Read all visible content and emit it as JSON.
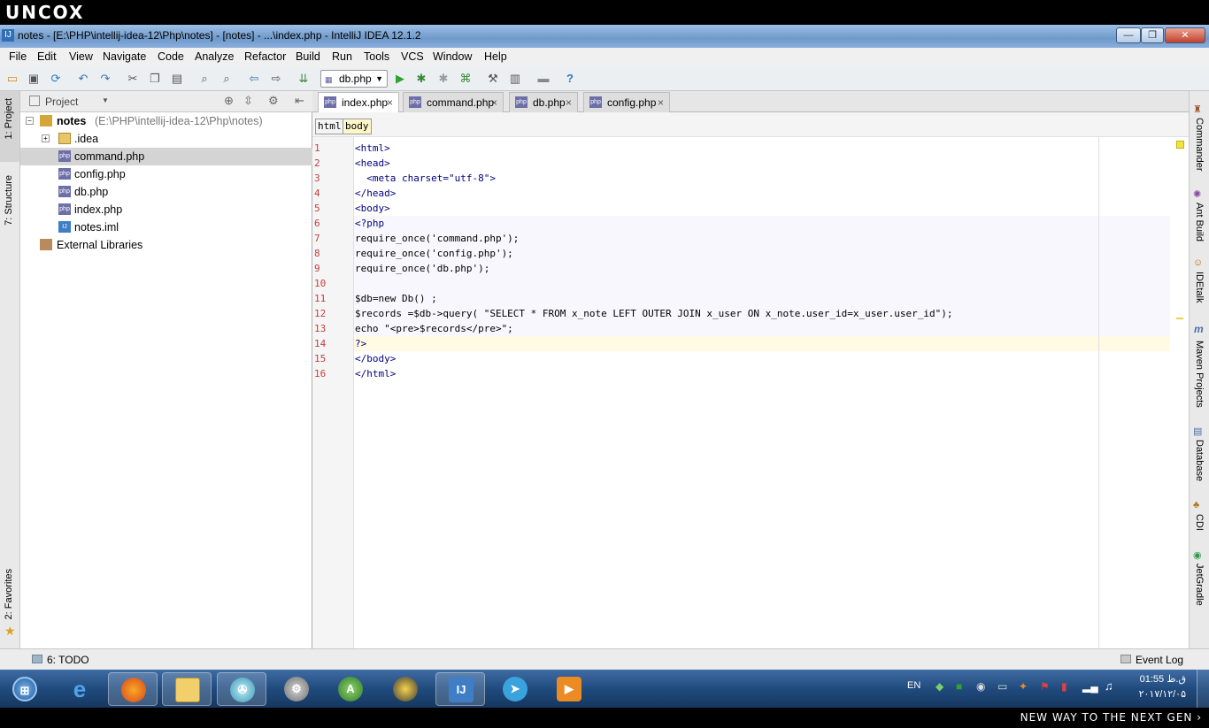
{
  "brand": {
    "logo": "UNCOX",
    "footer": "NEW WAY TO THE NEXT GEN ›"
  },
  "window": {
    "title": "notes - [E:\\PHP\\intellij-idea-12\\Php\\notes] - [notes] - ...\\index.php - IntelliJ IDEA 12.1.2",
    "minimize": "—",
    "maximize": "❐",
    "close": "✕"
  },
  "menu": [
    "File",
    "Edit",
    "View",
    "Navigate",
    "Code",
    "Analyze",
    "Refactor",
    "Build",
    "Run",
    "Tools",
    "VCS",
    "Window",
    "Help"
  ],
  "toolbar": {
    "run_config": "db.php",
    "help": "?"
  },
  "left_tool_tabs": {
    "project": "1: Project",
    "structure": "7: Structure",
    "favorites": "2: Favorites"
  },
  "project": {
    "header": "Project",
    "root": {
      "name": "notes",
      "path": "(E:\\PHP\\intellij-idea-12\\Php\\notes)"
    },
    "items": [
      {
        "name": ".idea",
        "type": "folder"
      },
      {
        "name": "command.php",
        "type": "php"
      },
      {
        "name": "config.php",
        "type": "php"
      },
      {
        "name": "db.php",
        "type": "php"
      },
      {
        "name": "index.php",
        "type": "php"
      },
      {
        "name": "notes.iml",
        "type": "iml"
      }
    ],
    "external": "External Libraries"
  },
  "tabs": [
    {
      "label": "index.php",
      "active": true
    },
    {
      "label": "command.php",
      "active": false
    },
    {
      "label": "db.php",
      "active": false
    },
    {
      "label": "config.php",
      "active": false
    }
  ],
  "breadcrumb": [
    "html",
    "body"
  ],
  "code_lines": [
    "<html>",
    "<head>",
    "  <meta charset=\"utf-8\">",
    "</head>",
    "<body>",
    "<?php",
    "require_once('command.php');",
    "require_once('config.php');",
    "require_once('db.php');",
    "",
    "$db=new Db() ;",
    "$records =$db->query( \"SELECT * FROM x_note LEFT OUTER JOIN x_user ON x_note.user_id=x_user.user_id\");",
    "echo \"<pre>$records</pre>\";",
    "?>",
    "</body>",
    "</html>"
  ],
  "line_numbers": [
    "1",
    "2",
    "3",
    "4",
    "5",
    "6",
    "7",
    "8",
    "9",
    "10",
    "11",
    "12",
    "13",
    "14",
    "15",
    "16"
  ],
  "right_tool_tabs": [
    "Commander",
    "Ant Build",
    "IDEtalk",
    "Maven Projects",
    "Database",
    "CDI",
    "JetGradle"
  ],
  "status": {
    "todo": "6: TODO",
    "event_log": "Event Log"
  },
  "taskbar": {
    "lang": "EN",
    "time": "01:55 ق.ظ",
    "date": "۲۰۱۷/۱۲/۰۵"
  }
}
